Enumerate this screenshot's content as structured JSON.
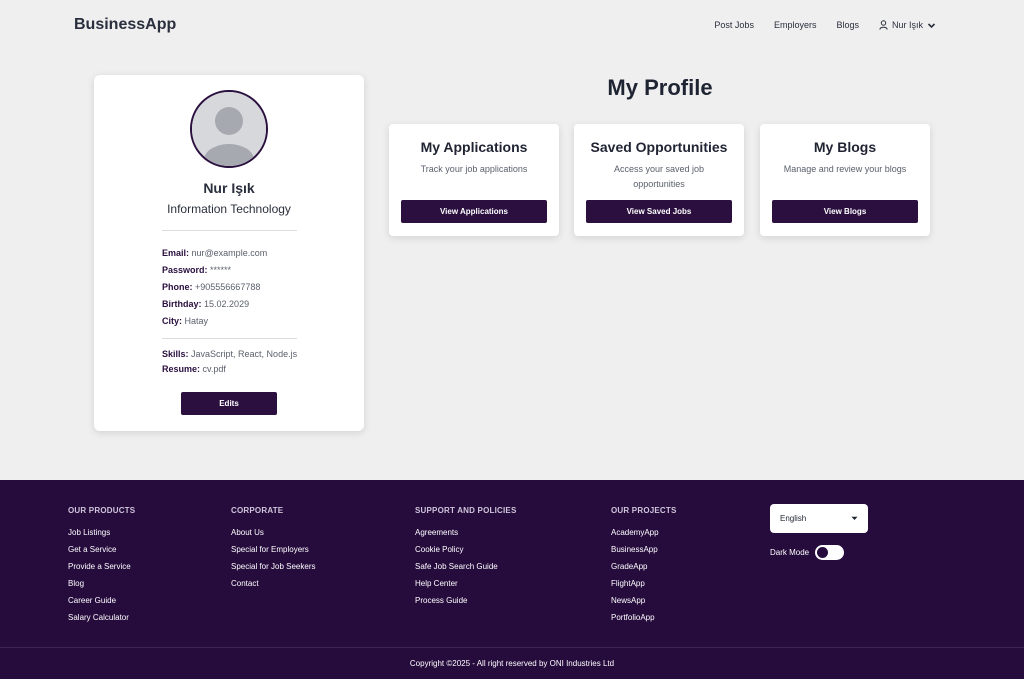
{
  "header": {
    "brand": "BusinessApp",
    "nav": [
      "Post Jobs",
      "Employers",
      "Blogs"
    ],
    "user_name": "Nur Işık"
  },
  "profile": {
    "name": "Nur Işık",
    "department": "Information Technology",
    "fields": [
      {
        "label": "Email:",
        "value": "nur@example.com"
      },
      {
        "label": "Password:",
        "value": "******"
      },
      {
        "label": "Phone:",
        "value": "+905556667788"
      },
      {
        "label": "Birthday:",
        "value": "15.02.2029"
      },
      {
        "label": "City:",
        "value": "Hatay"
      }
    ],
    "extra": [
      {
        "label": "Skills:",
        "value": "JavaScript, React, Node.js"
      },
      {
        "label": "Resume:",
        "value": "cv.pdf"
      }
    ],
    "edit_label": "Edits"
  },
  "main": {
    "title": "My Profile",
    "cards": [
      {
        "title": "My Applications",
        "desc": "Track your job applications",
        "button": "View Applications"
      },
      {
        "title": "Saved Opportunities",
        "desc": "Access your saved job opportunities",
        "button": "View Saved Jobs"
      },
      {
        "title": "My Blogs",
        "desc": "Manage and review your blogs",
        "button": "View Blogs"
      }
    ]
  },
  "footer": {
    "columns": [
      {
        "heading": "OUR PRODUCTS",
        "links": [
          "Job Listings",
          "Get a Service",
          "Provide a Service",
          "Blog",
          "Career Guide",
          "Salary Calculator"
        ]
      },
      {
        "heading": "CORPORATE",
        "links": [
          "About Us",
          "Special for Employers",
          "Special for Job Seekers",
          "Contact"
        ]
      },
      {
        "heading": "SUPPORT AND POLICIES",
        "links": [
          "Agreements",
          "Cookie Policy",
          "Safe Job Search Guide",
          "Help Center",
          "Process Guide"
        ]
      },
      {
        "heading": "OUR PROJECTS",
        "links": [
          "AcademyApp",
          "BusinessApp",
          "GradeApp",
          "FlightApp",
          "NewsApp",
          "PortfolioApp"
        ]
      }
    ],
    "language": "English",
    "dark_mode_label": "Dark Mode",
    "copyright": "Copyright ©2025 - All right reserved by ONI Industries Ltd"
  }
}
